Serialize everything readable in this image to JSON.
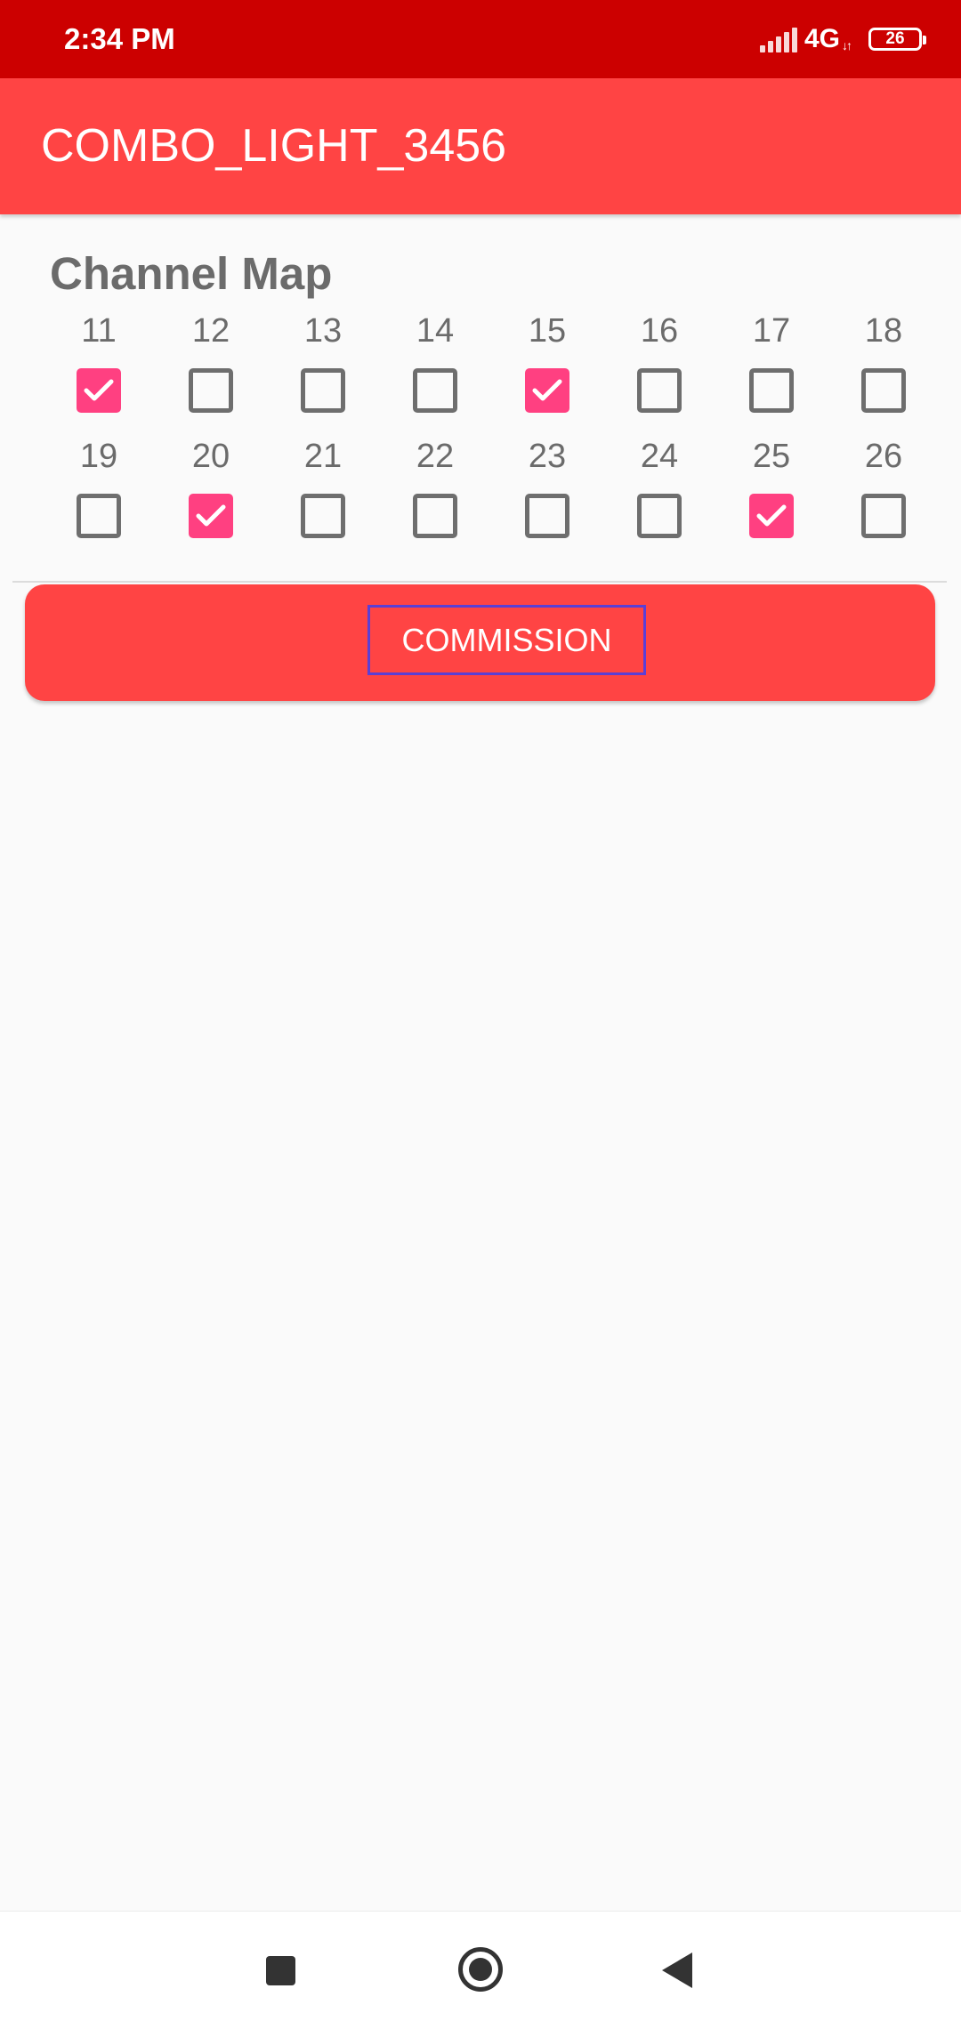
{
  "status_bar": {
    "time": "2:34 PM",
    "network": "4G",
    "battery": "26"
  },
  "app_bar": {
    "title": "COMBO_LIGHT_3456"
  },
  "channel_map": {
    "title": "Channel Map",
    "channels": [
      {
        "number": "11",
        "checked": true
      },
      {
        "number": "12",
        "checked": false
      },
      {
        "number": "13",
        "checked": false
      },
      {
        "number": "14",
        "checked": false
      },
      {
        "number": "15",
        "checked": true
      },
      {
        "number": "16",
        "checked": false
      },
      {
        "number": "17",
        "checked": false
      },
      {
        "number": "18",
        "checked": false
      },
      {
        "number": "19",
        "checked": false
      },
      {
        "number": "20",
        "checked": true
      },
      {
        "number": "21",
        "checked": false
      },
      {
        "number": "22",
        "checked": false
      },
      {
        "number": "23",
        "checked": false
      },
      {
        "number": "24",
        "checked": false
      },
      {
        "number": "25",
        "checked": true
      },
      {
        "number": "26",
        "checked": false
      }
    ]
  },
  "commission_button": {
    "label": "COMMISSION"
  },
  "colors": {
    "status_bar": "#cc0000",
    "app_bar": "#ff4444",
    "checkbox_checked": "#ff4081",
    "focus_outline": "#5b3fd6"
  },
  "nav_bar": {
    "icons": [
      "recents-icon",
      "home-icon",
      "back-icon"
    ]
  }
}
